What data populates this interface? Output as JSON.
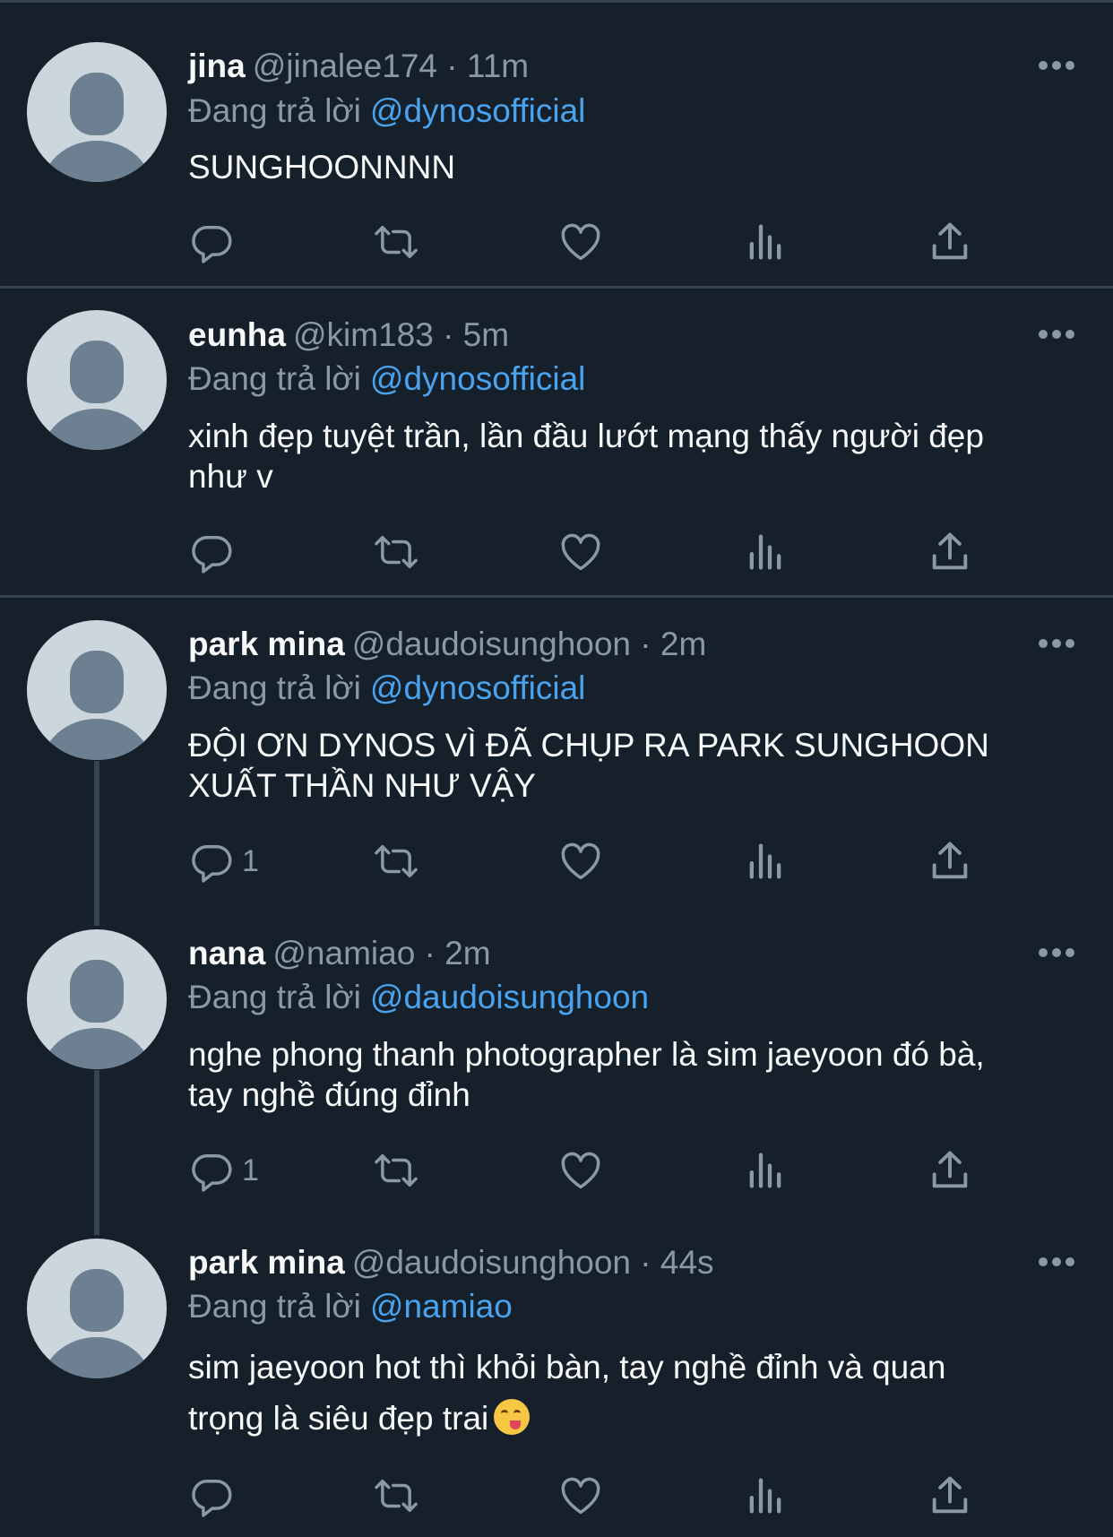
{
  "tweets": [
    {
      "name": "jina",
      "meta": "@jinalee174 · 11m",
      "reply_prefix": "Đang trả lời",
      "reply_to": "@dynosofficial",
      "text_lines": [
        "SUNGHOONNNN"
      ],
      "reply_count": "",
      "emoji": ""
    },
    {
      "name": "eunha",
      "meta": "@kim183 · 5m",
      "reply_prefix": "Đang trả lời",
      "reply_to": "@dynosofficial",
      "text_lines": [
        "xinh đẹp tuyệt trần, lần đầu lướt mạng thấy người đẹp",
        "như v"
      ],
      "reply_count": "",
      "emoji": ""
    },
    {
      "name": "park mina",
      "meta": "@daudoisunghoon · 2m",
      "reply_prefix": "Đang trả lời",
      "reply_to": "@dynosofficial",
      "text_lines": [
        "ĐỘI ƠN DYNOS VÌ ĐÃ CHỤP RA PARK SUNGHOON",
        "XUẤT THẦN NHƯ VẬY"
      ],
      "reply_count": "1",
      "emoji": ""
    },
    {
      "name": "nana",
      "meta": "@namiao · 2m",
      "reply_prefix": "Đang trả lời",
      "reply_to": "@daudoisunghoon",
      "text_lines": [
        "nghe phong thanh photographer là sim jaeyoon đó bà,",
        "tay nghề đúng đỉnh"
      ],
      "reply_count": "1",
      "emoji": ""
    },
    {
      "name": "park mina",
      "meta": "@daudoisunghoon · 44s",
      "reply_prefix": "Đang trả lời",
      "reply_to": "@namiao",
      "text_lines": [
        "sim jaeyoon hot thì khỏi bàn, tay nghề đỉnh và quan",
        "trọng là siêu đẹp trai"
      ],
      "reply_count": "",
      "emoji": "face-savoring-food"
    }
  ],
  "icons": {
    "reply": "reply-icon",
    "retweet": "retweet-icon",
    "like": "like-icon",
    "views": "views-icon",
    "share": "share-icon",
    "more": "more-icon"
  },
  "colors": {
    "background": "#15202b",
    "divider": "#38444d",
    "text": "#f7f9f9",
    "secondary": "#8b98a5",
    "mention": "#4aa3ee",
    "avatar_bg": "#ccd6dd",
    "avatar_fg": "#6d8092"
  }
}
